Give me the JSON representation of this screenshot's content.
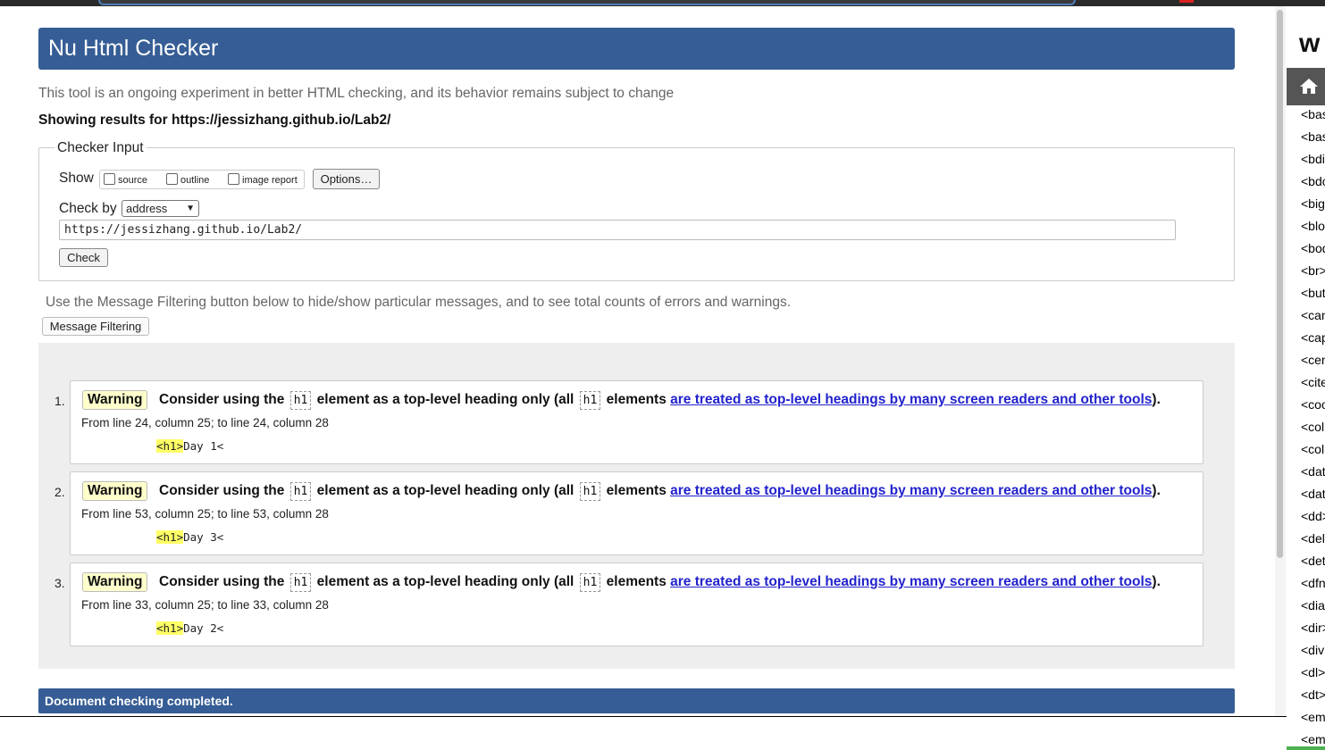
{
  "page": {
    "title": "Nu Html Checker",
    "intro": "This tool is an ongoing experiment in better HTML checking, and its behavior remains subject to change",
    "showing_results": "Showing results for https://jessizhang.github.io/Lab2/"
  },
  "checker_input": {
    "legend": "Checker Input",
    "show_label": "Show",
    "checkboxes": [
      {
        "label": "source",
        "checked": false
      },
      {
        "label": "outline",
        "checked": false
      },
      {
        "label": "image report",
        "checked": false
      }
    ],
    "options_button": "Options…",
    "check_by_label": "Check by",
    "check_by_value": "address",
    "url_value": "https://jessizhang.github.io/Lab2/",
    "check_button": "Check"
  },
  "filter": {
    "text": "Use the Message Filtering button below to hide/show particular messages, and to see total counts of errors and warnings.",
    "button": "Message Filtering"
  },
  "messages": [
    {
      "number": "1.",
      "type": "Warning",
      "text_before": "Consider using the",
      "code1": "h1",
      "text_mid": "element as a top-level heading only (all",
      "code2": "h1",
      "text_after": "elements",
      "link": "are treated as top-level headings by many screen readers and other tools",
      "end": ").",
      "location": "From line 24, column 25; to line 24, column 28",
      "extract_highlight": "<h1>",
      "extract_rest": "Day 1<"
    },
    {
      "number": "2.",
      "type": "Warning",
      "text_before": "Consider using the",
      "code1": "h1",
      "text_mid": "element as a top-level heading only (all",
      "code2": "h1",
      "text_after": "elements",
      "link": "are treated as top-level headings by many screen readers and other tools",
      "end": ").",
      "location": "From line 53, column 25; to line 53, column 28",
      "extract_highlight": "<h1>",
      "extract_rest": "Day 3<"
    },
    {
      "number": "3.",
      "type": "Warning",
      "text_before": "Consider using the",
      "code1": "h1",
      "text_mid": "element as a top-level heading only (all",
      "code2": "h1",
      "text_after": "elements",
      "link": "are treated as top-level headings by many screen readers and other tools",
      "end": ").",
      "location": "From line 33, column 25; to line 33, column 28",
      "extract_highlight": "<h1>",
      "extract_rest": "Day 2<"
    }
  ],
  "status": "Document checking completed.",
  "side_panel": {
    "logo": "w",
    "home_icon": "home-icon",
    "items": [
      "<bas",
      "<bas",
      "<bdi",
      "<bdo",
      "<big",
      "<blo",
      "<bod",
      "<br>",
      "<but",
      "<can",
      "<cap",
      "<cen",
      "<cite",
      "<coo",
      "<col",
      "<col",
      "<dat",
      "<dat",
      "<dd>",
      "<del",
      "<det",
      "<dfn",
      "<dia",
      "<dir>",
      "<div",
      "<dl>",
      "<dt>",
      "<em",
      "<em"
    ]
  },
  "colors": {
    "header_blue": "#365d95",
    "warning_badge": "#ffffcc",
    "code_highlight": "#ffff66",
    "link": "#2222cc"
  }
}
